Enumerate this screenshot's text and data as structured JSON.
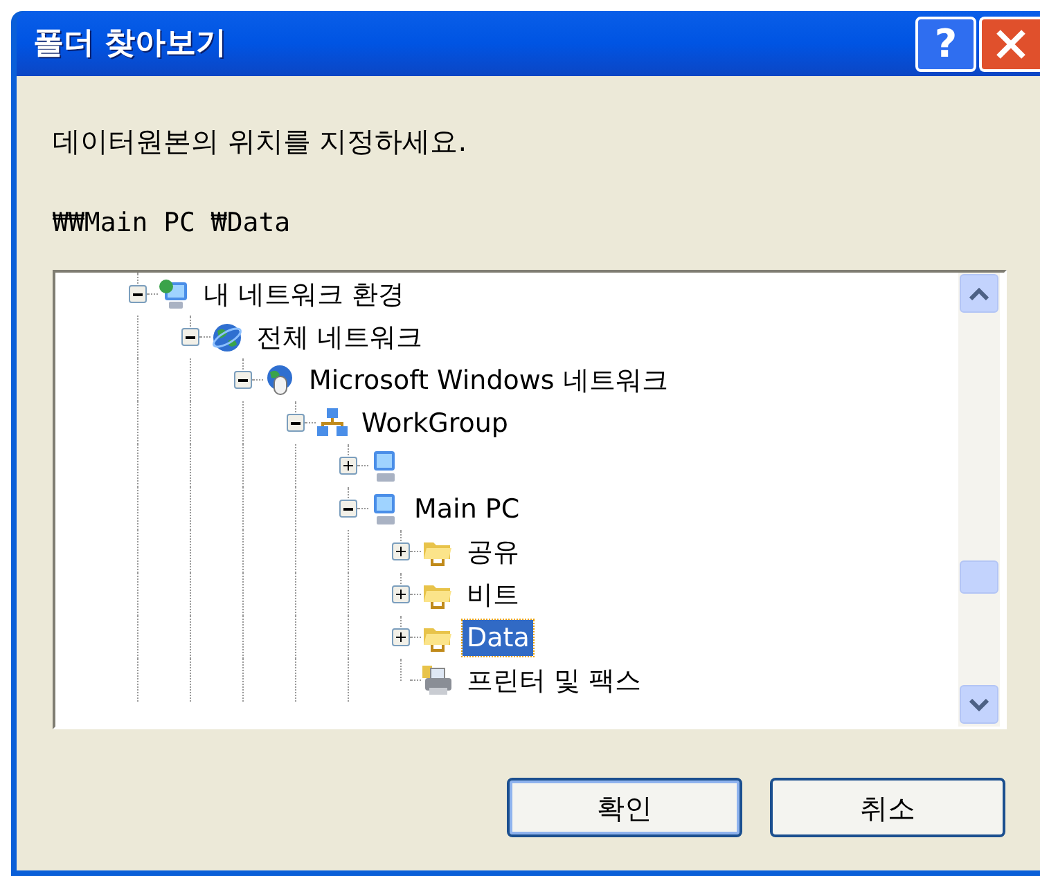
{
  "window": {
    "title": "폴더 찾아보기",
    "help_button": "?"
  },
  "prompt": "데이터원본의 위치를 지정하세요.",
  "path": "₩₩Main PC ₩Data",
  "tree": [
    {
      "label": "내 네트워크 환경",
      "kind": "network",
      "expanded": true,
      "selected": false,
      "children": [
        {
          "label": "전체 네트워크",
          "kind": "globe",
          "expanded": true,
          "selected": false,
          "children": [
            {
              "label": "Microsoft Windows 네트워크",
              "kind": "windows-network",
              "expanded": true,
              "selected": false,
              "children": [
                {
                  "label": "WorkGroup",
                  "kind": "workgroup",
                  "expanded": true,
                  "selected": false,
                  "children": [
                    {
                      "kind": "computer",
                      "expanded": false,
                      "selected": false
                    },
                    {
                      "label": "Main PC",
                      "kind": "computer",
                      "expanded": true,
                      "selected": false,
                      "children": [
                        {
                          "label": "공유",
                          "kind": "share",
                          "expanded": false,
                          "selected": false
                        },
                        {
                          "label": "비트",
                          "kind": "share",
                          "expanded": false,
                          "selected": false
                        },
                        {
                          "label": "Data",
                          "kind": "share",
                          "expanded": false,
                          "selected": true
                        },
                        {
                          "label": "프린터 및 팩스",
                          "kind": "printer",
                          "selected": false
                        }
                      ]
                    }
                  ]
                }
              ]
            }
          ]
        }
      ]
    }
  ],
  "buttons": [
    {
      "label": "확인",
      "default": true
    },
    {
      "label": "취소",
      "default": false
    }
  ]
}
